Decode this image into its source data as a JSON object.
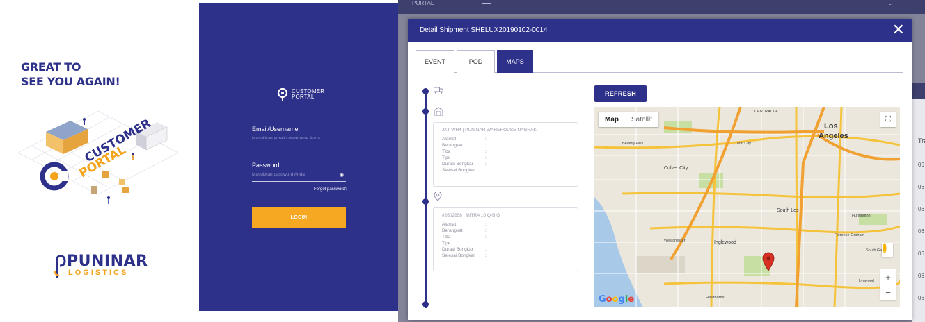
{
  "promo": {
    "tagline_line1": "GREAT TO",
    "tagline_line2": "SEE YOU AGAIN!",
    "illustration_word1": "CUSTOMER",
    "illustration_word2": "PORTAL",
    "brand_name": "PUNINAR",
    "brand_sub": "LOGISTICS"
  },
  "login": {
    "logo_line1": "CUSTOMER",
    "logo_line2": "PORTAL",
    "email_label": "Email/Username",
    "email_placeholder": "Masukkan email / username Anda",
    "password_label": "Password",
    "password_placeholder": "Masukkan password Anda",
    "forgot_label": "Forgot password?",
    "login_button": "LOGIN"
  },
  "app": {
    "topbar_title": "PORTAL",
    "topbar_right": "...",
    "right_col_header": "Tra",
    "right_col_values": [
      "06",
      "06",
      "06",
      "06",
      "06",
      "06",
      "06"
    ]
  },
  "modal": {
    "title": "Detail Shipment SHELUX20190102-0014",
    "close_symbol": "✕",
    "tabs": [
      {
        "label": "EVENT",
        "active": false
      },
      {
        "label": "POD",
        "active": false
      },
      {
        "label": "MAPS",
        "active": true
      }
    ],
    "refresh_label": "REFRESH",
    "card1": {
      "title": "JKT-WH4 | PUNINAR WAREHOUSE NAGRAK",
      "fields": [
        "Alamat",
        "Berangkat",
        "Tiba",
        "Tipe",
        "Durasi Bongkar",
        "Selesai Bongkar"
      ],
      "colon": ":"
    },
    "card2": {
      "title": "#2602958 | MITRA 10 Q-BIG",
      "fields": [
        "Alamat",
        "Berangkat",
        "Tiba",
        "Tipe",
        "Durasi Bongkar",
        "Selesai Bongkar"
      ],
      "colon": ":"
    }
  },
  "map": {
    "type_map": "Map",
    "type_satellite": "Satellit",
    "fullscreen_symbol": "⛶",
    "zoom_in": "+",
    "zoom_out": "−",
    "google_logo": "Google",
    "labels": {
      "los_angeles_1": "Los",
      "los_angeles_2": "Angeles",
      "culver_city": "Culver City",
      "south_los_angeles": "South Los",
      "inglewood": "Inglewood",
      "hawthorne": "Hawthorne",
      "westchester": "Westchester",
      "huntington_park": "Huntington",
      "florence_graham": "Florence-Graham",
      "south_gate": "South Gate",
      "lynwood": "Lynwood",
      "central_la": "CENTRAL LA",
      "mid_city": "Mid City",
      "beverly_hills": "Beverly Hills"
    },
    "marker_color": "#d93025"
  },
  "colors": {
    "brand_blue": "#2e3189",
    "accent_orange": "#f7a823"
  }
}
